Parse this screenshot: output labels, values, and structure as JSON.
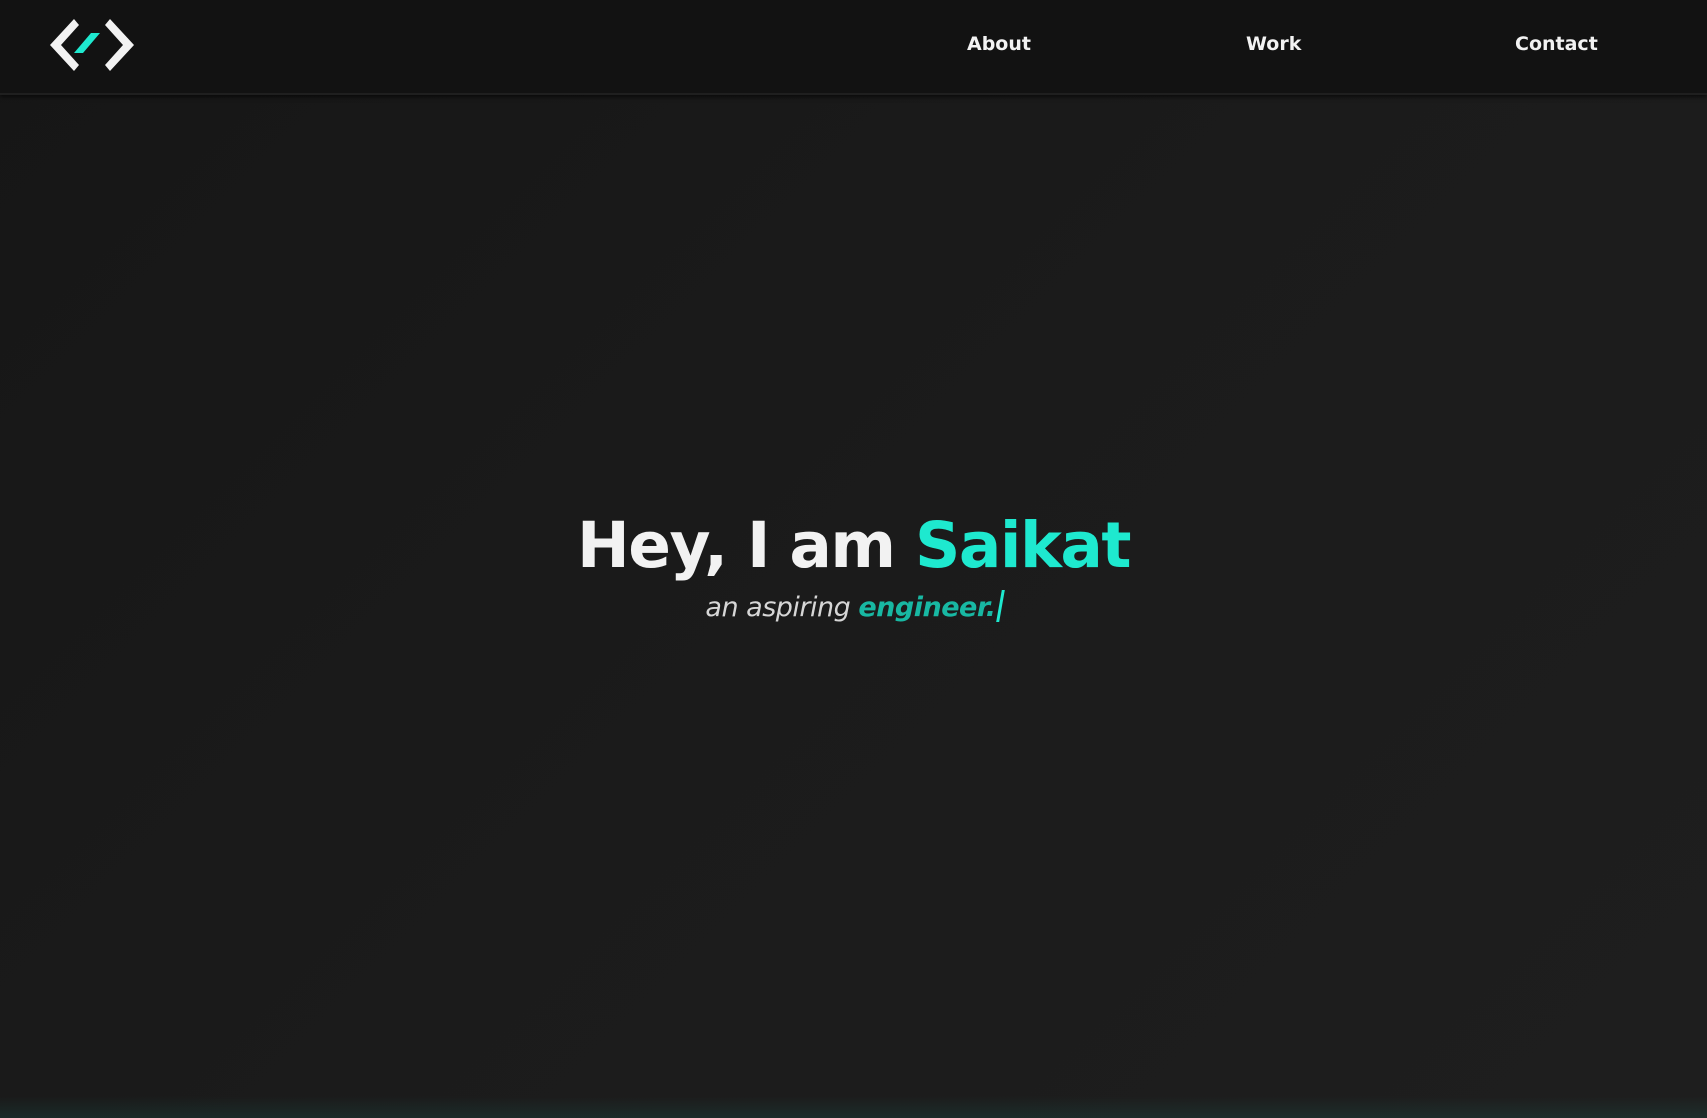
{
  "colors": {
    "accent": "#1ee9cf",
    "accent_muted": "#18b8a3",
    "background": "#1a1a1a",
    "header_background": "#121212",
    "text": "#f2f2f2"
  },
  "header": {
    "logo_icon": "code-brackets-logo-icon",
    "nav": [
      {
        "label": "About"
      },
      {
        "label": "Work"
      },
      {
        "label": "Contact"
      }
    ]
  },
  "hero": {
    "greeting": "Hey, I am",
    "name": "Saikat",
    "subtitle_prefix": "an aspiring",
    "role": "engineer."
  }
}
